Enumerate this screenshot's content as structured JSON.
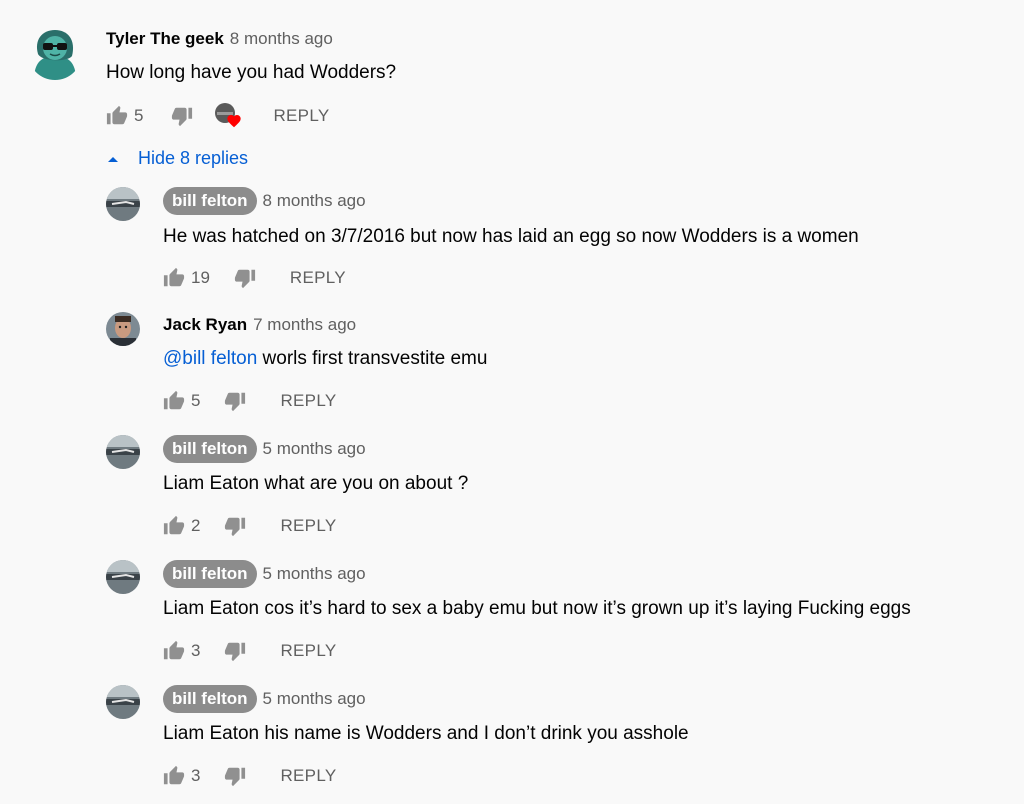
{
  "top_comment": {
    "author": "Tyler The geek",
    "time": "8 months ago",
    "text": "How long have you had Wodders?",
    "likes": "5",
    "reply_label": "REPLY"
  },
  "hide_replies_label": "Hide 8 replies",
  "replies": [
    {
      "author": "bill felton",
      "time": "8 months ago",
      "text": "He was hatched on 3/7/2016 but now has laid an egg so now Wodders is a women",
      "likes": "19",
      "reply_label": "REPLY"
    },
    {
      "author": "Jack Ryan",
      "time": "7 months ago",
      "mention": "@bill felton",
      "text": " worls first transvestite emu",
      "likes": "5",
      "reply_label": "REPLY"
    },
    {
      "author": "bill felton",
      "time": "5 months ago",
      "text": "Liam Eaton what are you on about ?",
      "likes": "2",
      "reply_label": "REPLY"
    },
    {
      "author": "bill felton",
      "time": "5 months ago",
      "text": "Liam Eaton cos it’s hard to sex a baby emu but now it’s grown up it’s laying Fucking eggs",
      "likes": "3",
      "reply_label": "REPLY"
    },
    {
      "author": "bill felton",
      "time": "5 months ago",
      "text": "Liam Eaton his name is Wodders and I don’t drink you asshole",
      "likes": "3",
      "reply_label": "REPLY"
    }
  ],
  "colors": {
    "background": "#f9f9f9",
    "link": "#065fd4",
    "secondary_text": "#606060",
    "author_chip": "#8c8c8c",
    "heart": "#ff0000"
  },
  "icons": [
    "thumbs-up-icon",
    "thumbs-down-icon",
    "creator-heart-icon",
    "caret-up-icon"
  ]
}
